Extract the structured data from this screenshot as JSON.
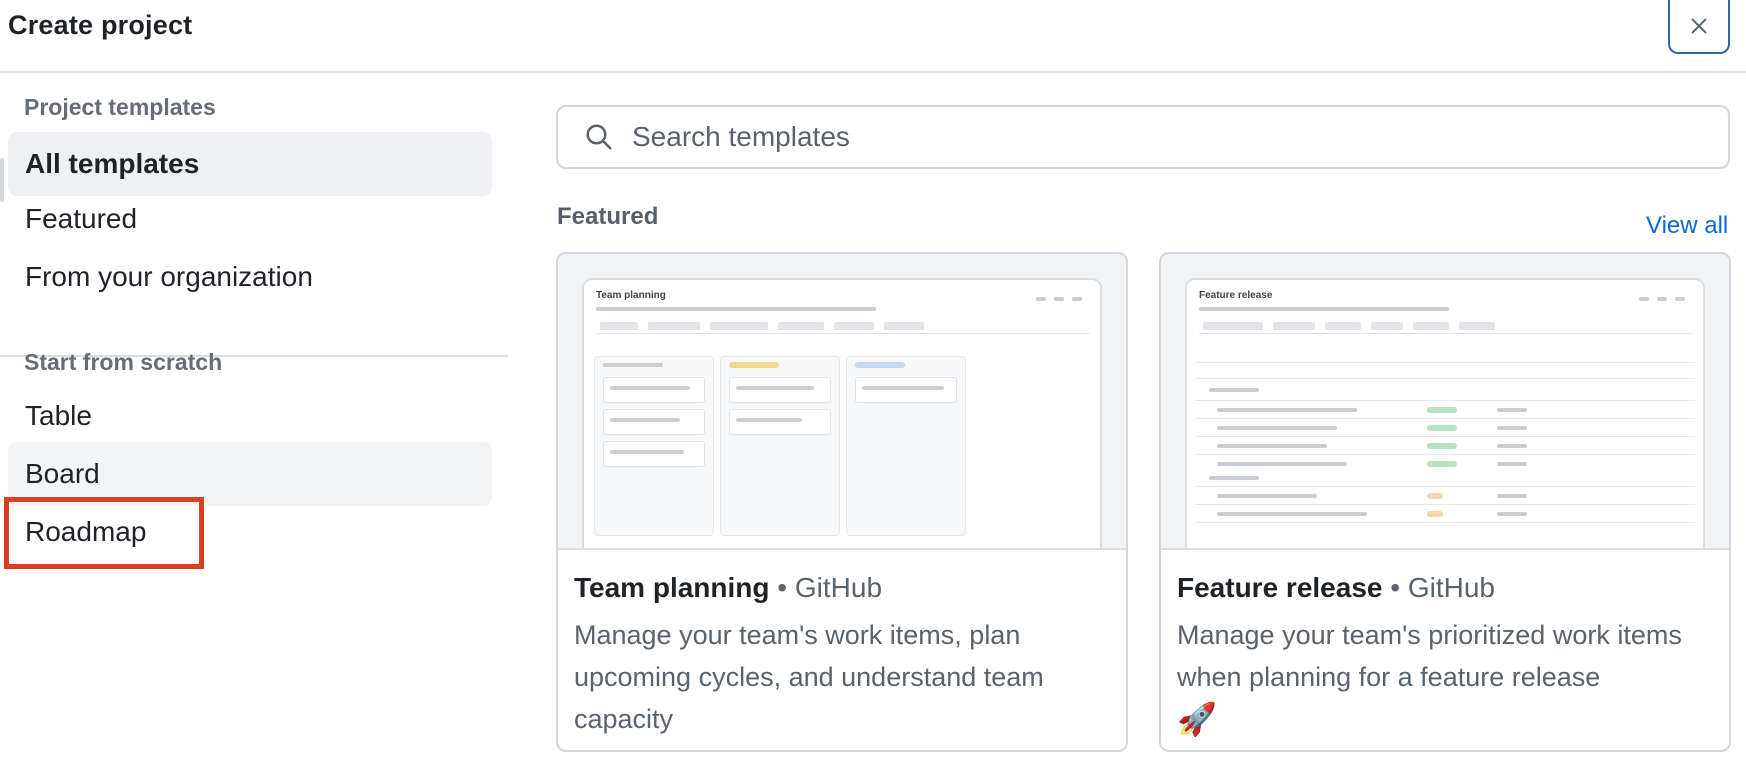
{
  "dialog": {
    "title": "Create project",
    "close_label": "×"
  },
  "sidebar": {
    "templates_heading": "Project templates",
    "template_items": [
      {
        "label": "All templates",
        "active": true
      },
      {
        "label": "Featured",
        "active": false
      },
      {
        "label": "From your organization",
        "active": false
      }
    ],
    "scratch_heading": "Start from scratch",
    "scratch_items": [
      {
        "label": "Table"
      },
      {
        "label": "Board",
        "highlighted": true
      },
      {
        "label": "Roadmap"
      }
    ]
  },
  "search": {
    "placeholder": "Search templates",
    "value": ""
  },
  "featured": {
    "label": "Featured",
    "view_all": "View all",
    "cards": [
      {
        "name": "Team planning",
        "separator": "•",
        "owner": "GitHub",
        "description": "Manage your team's work items, plan upcoming cycles, and understand team capacity",
        "preview_title": "Team planning",
        "emoji": ""
      },
      {
        "name": "Feature release",
        "separator": "•",
        "owner": "GitHub",
        "description": "Manage your team's prioritized work items when planning for a feature release",
        "preview_title": "Feature release",
        "emoji": "🚀"
      }
    ]
  },
  "colors": {
    "accent_link": "#0969da",
    "highlight_box": "#d9411e",
    "close_border": "#2f66a8",
    "active_bg": "#eef0f3"
  }
}
